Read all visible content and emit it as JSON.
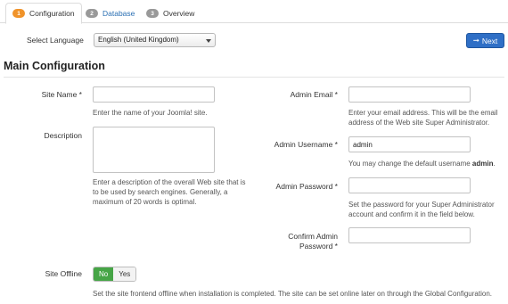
{
  "tabs": [
    {
      "num": "1",
      "label": "Configuration",
      "color": "#f0932a"
    },
    {
      "num": "2",
      "label": "Database",
      "color": "#999999"
    },
    {
      "num": "3",
      "label": "Overview",
      "color": "#999999"
    }
  ],
  "language": {
    "label": "Select Language",
    "value": "English (United Kingdom)"
  },
  "next_button": {
    "label": "Next",
    "icon": "arrow-right-icon",
    "color": "#2f6fc6"
  },
  "heading": "Main Configuration",
  "site_name": {
    "label": "Site Name *",
    "value": "",
    "help": "Enter the name of your Joomla! site."
  },
  "description": {
    "label": "Description",
    "value": "",
    "help": "Enter a description of the overall Web site that is to be used by search engines. Generally, a maximum of 20 words is optimal."
  },
  "admin_email": {
    "label": "Admin Email *",
    "value": "",
    "help": "Enter your email address. This will be the email address of the Web site Super Administrator."
  },
  "admin_username": {
    "label": "Admin Username *",
    "value": "admin",
    "help_prefix": "You may change the default username ",
    "help_bold": "admin",
    "help_suffix": "."
  },
  "admin_password": {
    "label": "Admin Password *",
    "value": "",
    "help": "Set the password for your Super Administrator account and confirm it in the field below."
  },
  "confirm_password": {
    "label_line1": "Confirm Admin",
    "label_line2": "Password *",
    "value": ""
  },
  "site_offline": {
    "label": "Site Offline",
    "options": [
      "No",
      "Yes"
    ],
    "selected": "No",
    "active_color": "#46a546",
    "help": "Set the site frontend offline when installation is completed. The site can be set online later on through the Global Configuration."
  }
}
